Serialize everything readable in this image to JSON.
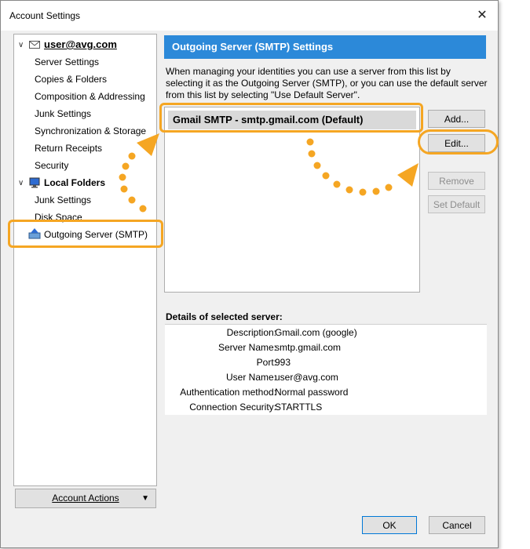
{
  "window": {
    "title": "Account Settings",
    "close_glyph": "✕"
  },
  "tree": {
    "account": {
      "label": "user@avg.com",
      "icon": "envelope-icon"
    },
    "account_items": [
      "Server Settings",
      "Copies & Folders",
      "Composition & Addressing",
      "Junk Settings",
      "Synchronization & Storage",
      "Return Receipts",
      "Security"
    ],
    "local": {
      "label": "Local Folders",
      "icon": "computer-icon"
    },
    "local_items": [
      "Junk Settings",
      "Disk Space"
    ],
    "outgoing": {
      "label": "Outgoing Server (SMTP)",
      "icon": "outgoing-server-icon"
    }
  },
  "account_actions": {
    "label": "Account Actions"
  },
  "panel": {
    "header": "Outgoing Server (SMTP) Settings",
    "description": "When managing your identities you can use a server from this list by selecting it as the Outgoing Server (SMTP), or you can use the default server from this list by selecting \"Use Default Server\".",
    "servers": [
      "Gmail SMTP - smtp.gmail.com (Default)"
    ]
  },
  "buttons": {
    "add": "Add...",
    "edit": "Edit...",
    "remove": "Remove",
    "set_default": "Set Default",
    "ok": "OK",
    "cancel": "Cancel"
  },
  "details": {
    "label": "Details of selected server:",
    "rows": [
      {
        "label": "Description:",
        "value": "Gmail.com (google)"
      },
      {
        "label": "Server Name:",
        "value": "smtp.gmail.com"
      },
      {
        "label": "Port:",
        "value": "993"
      },
      {
        "label": "User Name:",
        "value": "user@avg.com"
      },
      {
        "label": "Authentication method:",
        "value": "Normal password"
      },
      {
        "label": "Connection Security:",
        "value": "STARTTLS"
      }
    ]
  },
  "colors": {
    "header_bg": "#2c89d9",
    "highlight": "#f5a623"
  }
}
